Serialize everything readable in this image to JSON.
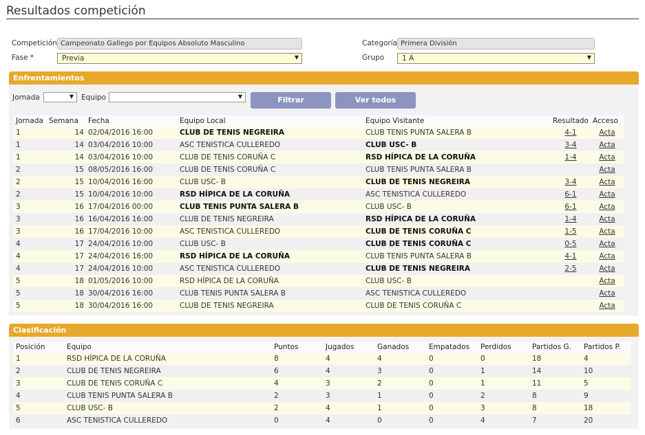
{
  "page_title": "Resultados competición",
  "filters": {
    "competicion_label": "Competición",
    "competicion_value": "Campeonato Gallego por Equipos Absoluto Masculino",
    "categoria_label": "Categoría",
    "categoria_value": "Primera División",
    "fase_label": "Fase *",
    "fase_value": "Previa",
    "grupo_label": "Grupo",
    "grupo_value": "1 A"
  },
  "enfrentamientos": {
    "title": "Enfrentamientos",
    "jornada_label": "Jornada",
    "equipo_label": "Equipo",
    "filtrar_label": "Filtrar",
    "ver_todos_label": "Ver todos",
    "headers": [
      "Jornada",
      "Semana",
      "Fecha",
      "Equipo Local",
      "Equipo Visitante",
      "Resultado",
      "Acceso"
    ],
    "rows": [
      {
        "jornada": "1",
        "semana": "14",
        "fecha": "02/04/2016 16:00",
        "local": "CLUB DE TENIS NEGREIRA",
        "visitante": "CLUB TENIS PUNTA SALERA B",
        "resultado": "4-1",
        "acceso": "Acta",
        "winner": "local"
      },
      {
        "jornada": "1",
        "semana": "14",
        "fecha": "03/04/2016 10:00",
        "local": "ASC TENISTICA CULLEREDO",
        "visitante": "CLUB USC- B",
        "resultado": "3-4",
        "acceso": "Acta",
        "winner": "visitante"
      },
      {
        "jornada": "1",
        "semana": "14",
        "fecha": "03/04/2016 10:00",
        "local": "CLUB DE TENIS CORUÑA C",
        "visitante": "RSD HÍPICA DE LA CORUÑA",
        "resultado": "1-4",
        "acceso": "Acta",
        "winner": "visitante"
      },
      {
        "jornada": "2",
        "semana": "15",
        "fecha": "08/05/2016 16:00",
        "local": "CLUB DE TENIS CORUÑA C",
        "visitante": "CLUB TENIS PUNTA SALERA B",
        "resultado": "",
        "acceso": "Acta",
        "winner": ""
      },
      {
        "jornada": "2",
        "semana": "15",
        "fecha": "10/04/2016 16:00",
        "local": "CLUB USC- B",
        "visitante": "CLUB DE TENIS NEGREIRA",
        "resultado": "3-4",
        "acceso": "Acta",
        "winner": "visitante"
      },
      {
        "jornada": "2",
        "semana": "15",
        "fecha": "10/04/2016 10:00",
        "local": "RSD HÍPICA DE LA CORUÑA",
        "visitante": "ASC TENISTICA CULLEREDO",
        "resultado": "6-1",
        "acceso": "Acta",
        "winner": "local"
      },
      {
        "jornada": "3",
        "semana": "16",
        "fecha": "17/04/2016 00:00",
        "local": "CLUB TENIS PUNTA SALERA B",
        "visitante": "CLUB USC- B",
        "resultado": "6-1",
        "acceso": "Acta",
        "winner": "local"
      },
      {
        "jornada": "3",
        "semana": "16",
        "fecha": "16/04/2016 16:00",
        "local": "CLUB DE TENIS NEGREIRA",
        "visitante": "RSD HÍPICA DE LA CORUÑA",
        "resultado": "1-4",
        "acceso": "Acta",
        "winner": "visitante"
      },
      {
        "jornada": "3",
        "semana": "16",
        "fecha": "17/04/2016 10:00",
        "local": "ASC TENISTICA CULLEREDO",
        "visitante": "CLUB DE TENIS CORUÑA C",
        "resultado": "1-5",
        "acceso": "Acta",
        "winner": "visitante"
      },
      {
        "jornada": "4",
        "semana": "17",
        "fecha": "24/04/2016 10:00",
        "local": "CLUB USC- B",
        "visitante": "CLUB DE TENIS CORUÑA C",
        "resultado": "0-5",
        "acceso": "Acta",
        "winner": "visitante"
      },
      {
        "jornada": "4",
        "semana": "17",
        "fecha": "24/04/2016 16:00",
        "local": "RSD HÍPICA DE LA CORUÑA",
        "visitante": "CLUB TENIS PUNTA SALERA B",
        "resultado": "4-1",
        "acceso": "Acta",
        "winner": "local"
      },
      {
        "jornada": "4",
        "semana": "17",
        "fecha": "24/04/2016 10:00",
        "local": "ASC TENISTICA CULLEREDO",
        "visitante": "CLUB DE TENIS NEGREIRA",
        "resultado": "2-5",
        "acceso": "Acta",
        "winner": "visitante"
      },
      {
        "jornada": "5",
        "semana": "18",
        "fecha": "01/05/2016 10:00",
        "local": "RSD HÍPICA DE LA CORUÑA",
        "visitante": "CLUB USC- B",
        "resultado": "",
        "acceso": "Acta",
        "winner": ""
      },
      {
        "jornada": "5",
        "semana": "18",
        "fecha": "30/04/2016 16:00",
        "local": "CLUB TENIS PUNTA SALERA B",
        "visitante": "ASC TENISTICA CULLEREDO",
        "resultado": "",
        "acceso": "Acta",
        "winner": ""
      },
      {
        "jornada": "5",
        "semana": "18",
        "fecha": "30/04/2016 16:00",
        "local": "CLUB DE TENIS NEGREIRA",
        "visitante": "CLUB DE TENIS CORUÑA C",
        "resultado": "",
        "acceso": "Acta",
        "winner": ""
      }
    ]
  },
  "clasificacion": {
    "title": "Clasificación",
    "headers": [
      "Posición",
      "Equipo",
      "Puntos",
      "Jugados",
      "Ganados",
      "Empatados",
      "Perdidos",
      "Partidos G.",
      "Partidos P."
    ],
    "rows": [
      [
        "1",
        "RSD HÍPICA DE LA CORUÑA",
        "8",
        "4",
        "4",
        "0",
        "0",
        "18",
        "4"
      ],
      [
        "2",
        "CLUB DE TENIS NEGREIRA",
        "6",
        "4",
        "3",
        "0",
        "1",
        "14",
        "10"
      ],
      [
        "3",
        "CLUB DE TENIS CORUÑA C",
        "4",
        "3",
        "2",
        "0",
        "1",
        "11",
        "5"
      ],
      [
        "4",
        "CLUB TENIS PUNTA SALERA B",
        "2",
        "3",
        "1",
        "0",
        "2",
        "8",
        "9"
      ],
      [
        "5",
        "CLUB USC- B",
        "2",
        "4",
        "1",
        "0",
        "3",
        "8",
        "18"
      ],
      [
        "6",
        "ASC TENISTICA CULLEREDO",
        "0",
        "4",
        "0",
        "0",
        "4",
        "7",
        "20"
      ]
    ]
  },
  "colors": {
    "accent": "#e7a82c",
    "button": "#8b95c0",
    "select_bg": "#ffffd6"
  }
}
